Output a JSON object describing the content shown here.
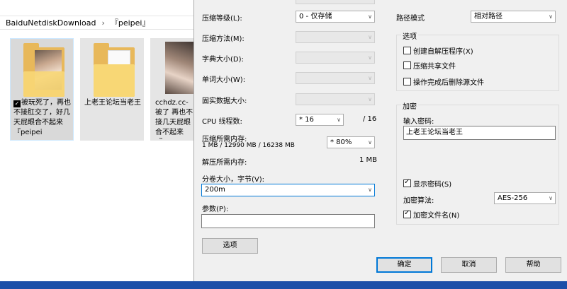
{
  "explorer": {
    "breadcrumb": [
      "BaiduNetdiskDownload",
      "『peipei』"
    ],
    "breadcrumb_sep": "›",
    "files": [
      {
        "name_prefix": "",
        "name": "被玩死了，再也不接肛交了，好几天屁眼合不起来『peipei",
        "check": "✓"
      },
      {
        "name_prefix": "",
        "name": "上老王论坛当老王",
        "check": ""
      },
      {
        "name_prefix": "",
        "name": "cchdz.cc-被了 再也不接几天屁眼合不起来『pe",
        "check": ""
      }
    ]
  },
  "dialog": {
    "left": {
      "compression_level_label": "压缩等级(L):",
      "compression_level_value": "0 - 仅存储",
      "compression_method_label": "压缩方法(M):",
      "dictionary_size_label": "字典大小(D):",
      "word_size_label": "单词大小(W):",
      "solid_block_label": "固实数据大小:",
      "cpu_threads_label": "CPU 线程数:",
      "cpu_threads_value": "* 16",
      "cpu_threads_total": "/ 16",
      "memory_compress_label": "压缩所需内存:",
      "memory_compress_detail": "1 MB / 12990 MB / 16238 MB",
      "memory_percent_value": "* 80%",
      "memory_decompress_label": "解压所需内存:",
      "memory_decompress_value": "1 MB",
      "volume_size_label": "分卷大小，字节(V):",
      "volume_size_value": "200m",
      "params_label": "参数(P):",
      "params_value": "",
      "options_button": "选项"
    },
    "right": {
      "path_mode_label": "路径模式",
      "path_mode_value": "相对路径",
      "options_group_title": "选项",
      "opt_sfx": "创建自解压程序(X)",
      "opt_shared": "压缩共享文件",
      "opt_delete": "操作完成后删除源文件",
      "encryption_group_title": "加密",
      "password_label": "输入密码:",
      "password_value": "上老王论坛当老王",
      "show_password_label": "显示密码(S)",
      "encryption_method_label": "加密算法:",
      "encryption_method_value": "AES-256",
      "encrypt_names_label": "加密文件名(N)"
    },
    "buttons": {
      "ok": "确定",
      "cancel": "取消",
      "help": "帮助"
    },
    "arrow_glyph": "∨"
  },
  "colors": {
    "dialog_bg": "#f0f0f0",
    "accent": "#0078d7",
    "taskbar": "#1c4fa8"
  }
}
